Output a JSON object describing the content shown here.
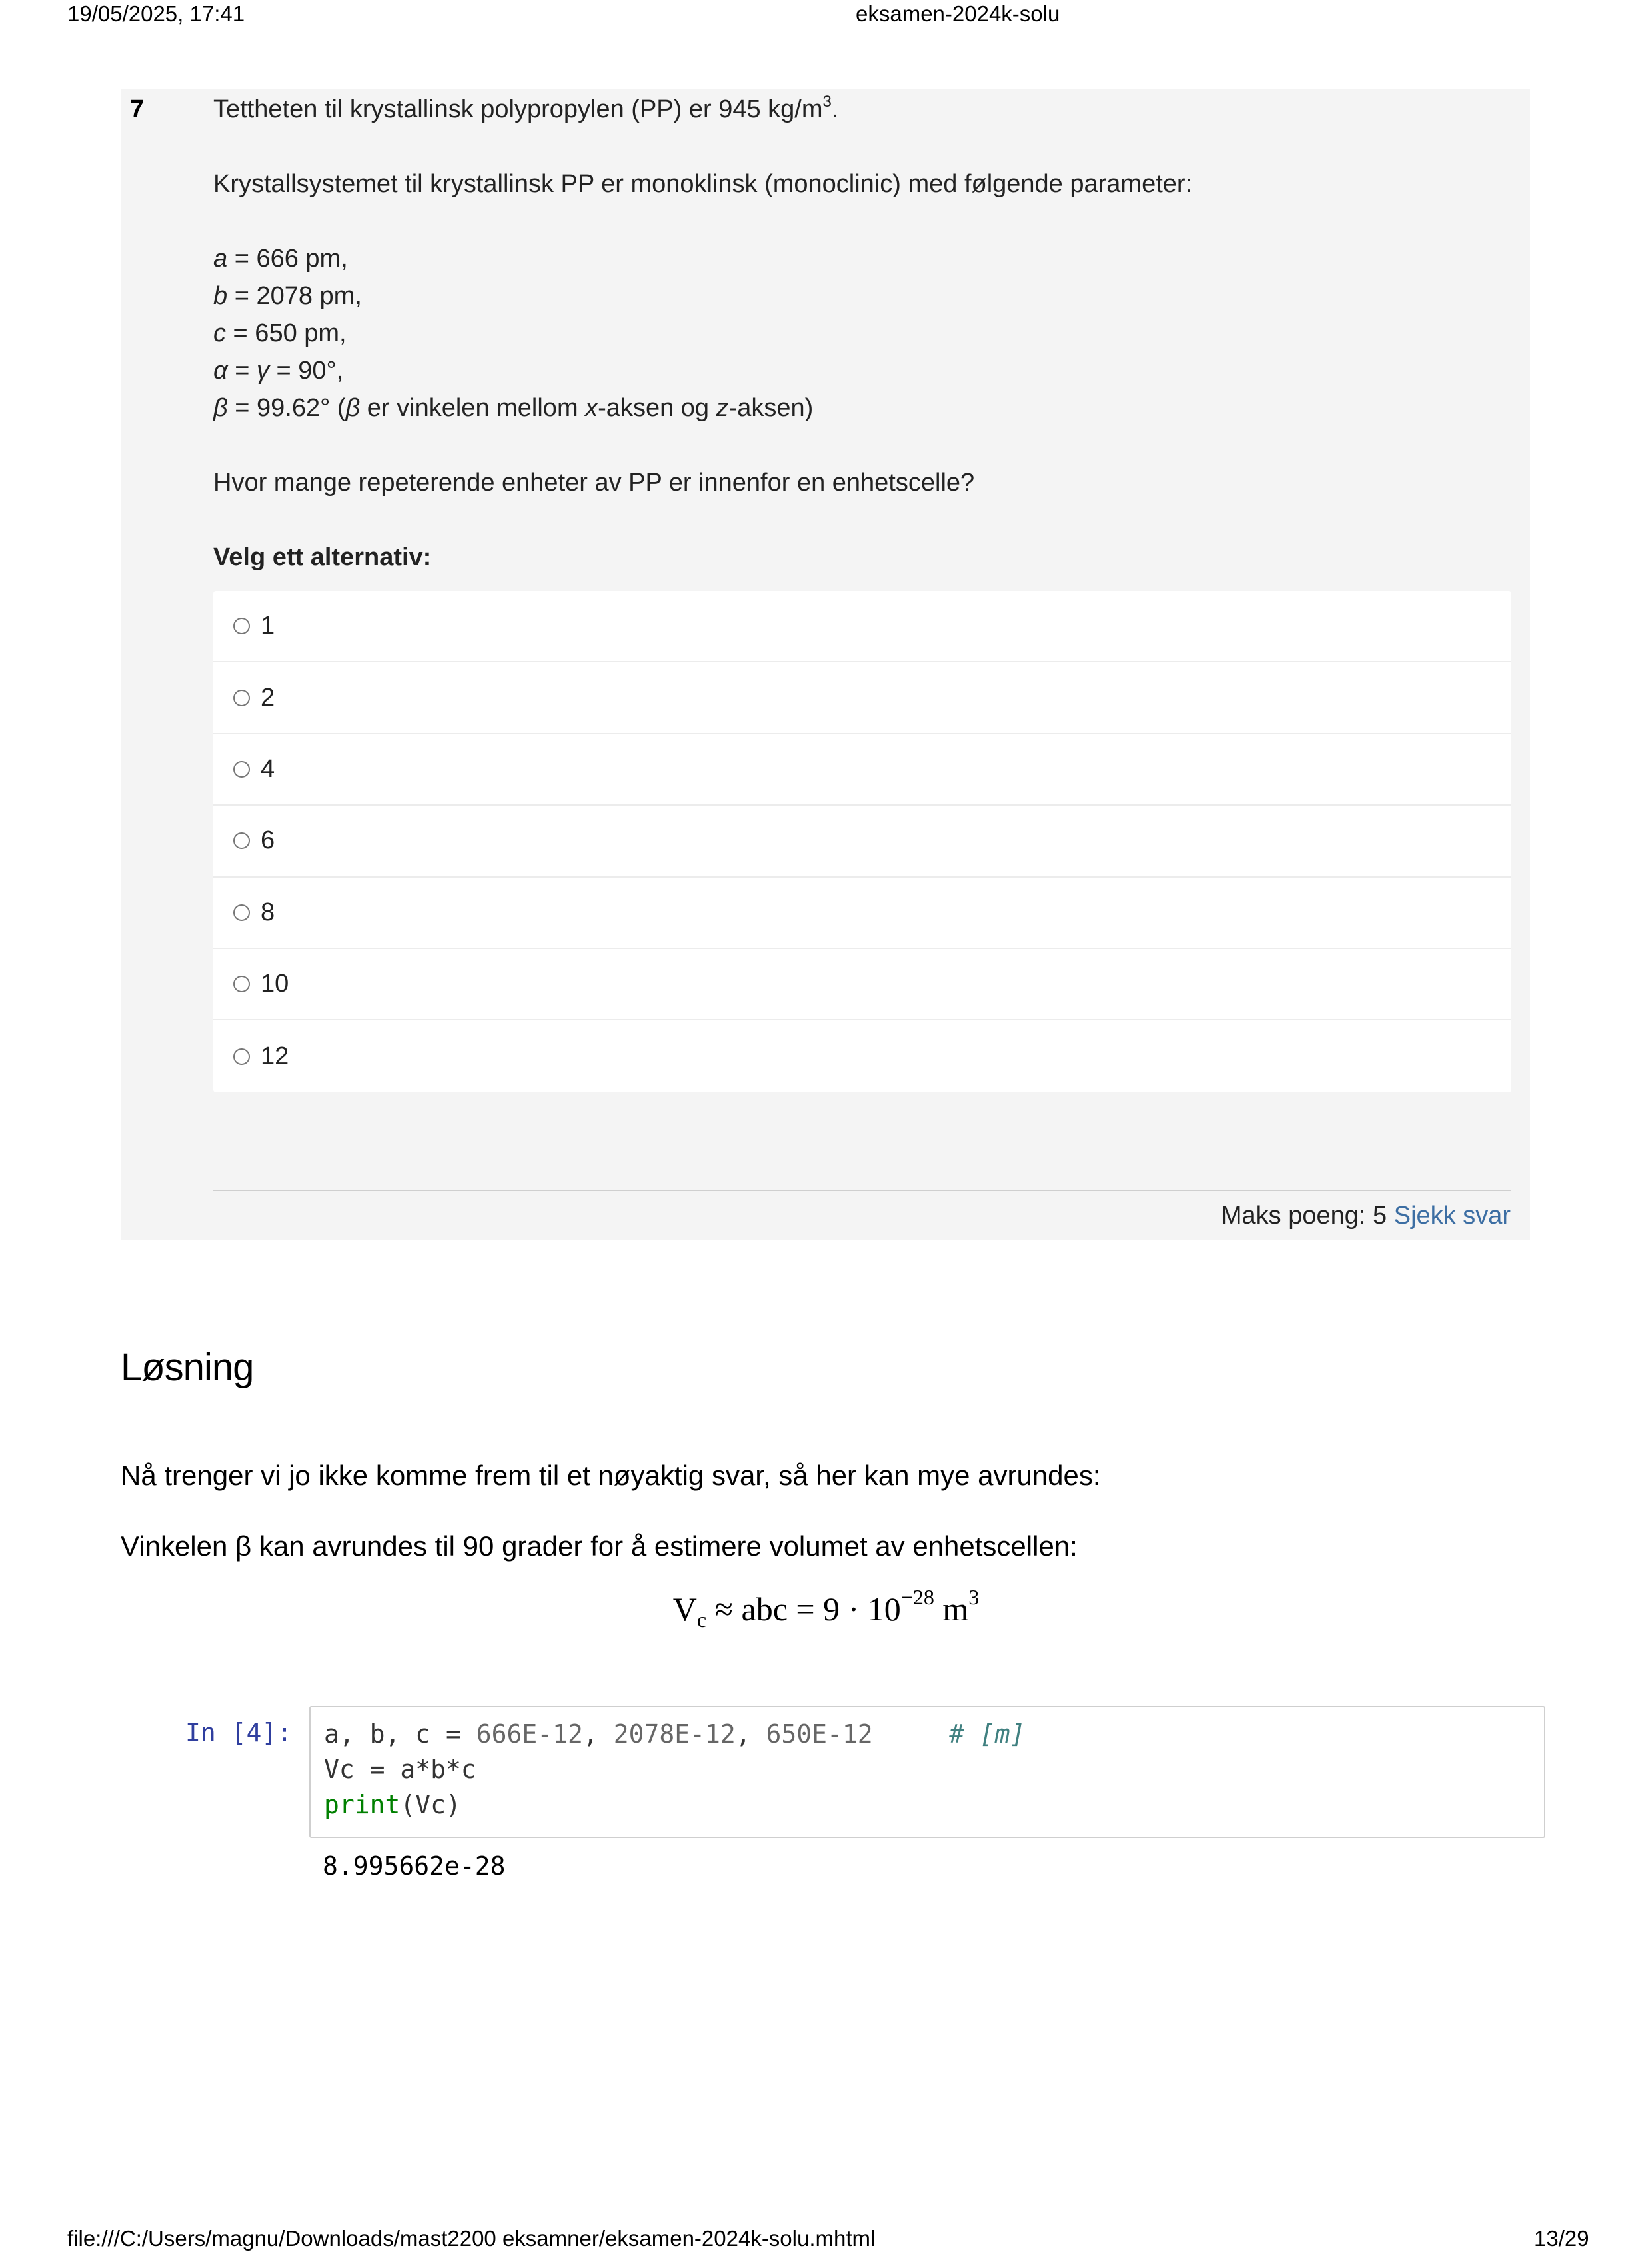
{
  "print_header": {
    "datetime": "19/05/2025, 17:41",
    "doc_title": "eksamen-2024k-solu"
  },
  "question": {
    "number": "7",
    "density_text": "Tettheten til krystallinsk polypropylen (PP) er 945 kg/m",
    "density_exp": "3",
    "density_end": ".",
    "system_text": "Krystallsystemet til krystallinsk PP er monoklinsk (monoclinic) med følgende parameter:",
    "params": {
      "a_sym": "a",
      "a_val": " = 666 pm,",
      "b_sym": "b",
      "b_val": " = 2078 pm,",
      "c_sym": "c",
      "c_val": " = 650 pm,",
      "alpha_sym": "α",
      "alpha_mid": " = ",
      "gamma_sym": "γ",
      "alpha_val": " = 90°,",
      "beta_sym": "β",
      "beta_val": " = 99.62° (",
      "beta_sym2": "β",
      "beta_desc1": " er vinkelen mellom ",
      "x_sym": "x",
      "beta_desc2": "-aksen og ",
      "z_sym": "z",
      "beta_desc3": "-aksen)"
    },
    "prompt": "Hvor mange repeterende enheter av PP er innenfor en enhetscelle?",
    "choose_label": "Velg ett alternativ:",
    "options": [
      "1",
      "2",
      "4",
      "6",
      "8",
      "10",
      "12"
    ],
    "max_points_label": "Maks poeng: 5",
    "check_link": "Sjekk svar"
  },
  "solution": {
    "title": "Løsning",
    "para1": "Nå trenger vi jo ikke komme frem til et nøyaktig svar, så her kan mye avrundes:",
    "para2": "Vinkelen β kan avrundes til 90 grader for å estimere volumet av enhetscellen:",
    "formula": {
      "V": "V",
      "sub": "c",
      "mid": " ≈ abc = 9 · 10",
      "exp": "−28",
      "unit": " m",
      "unit_exp": "3"
    },
    "code_cell": {
      "prompt": "In [4]:",
      "line1_vars": "a, b, c = ",
      "line1_v1": "666E-12",
      "line1_sep1": ", ",
      "line1_v2": "2078E-12",
      "line1_sep2": ", ",
      "line1_v3": "650E-12",
      "line1_pad": "     ",
      "line1_comment": "# [m]",
      "line2": "Vc = a*b*c",
      "line3_fn": "print",
      "line3_args": "(Vc)",
      "output": "8.995662e-28"
    }
  },
  "print_footer": {
    "path": "file:///C:/Users/magnu/Downloads/mast2200 eksamner/eksamen-2024k-solu.mhtml",
    "page": "13/29"
  }
}
